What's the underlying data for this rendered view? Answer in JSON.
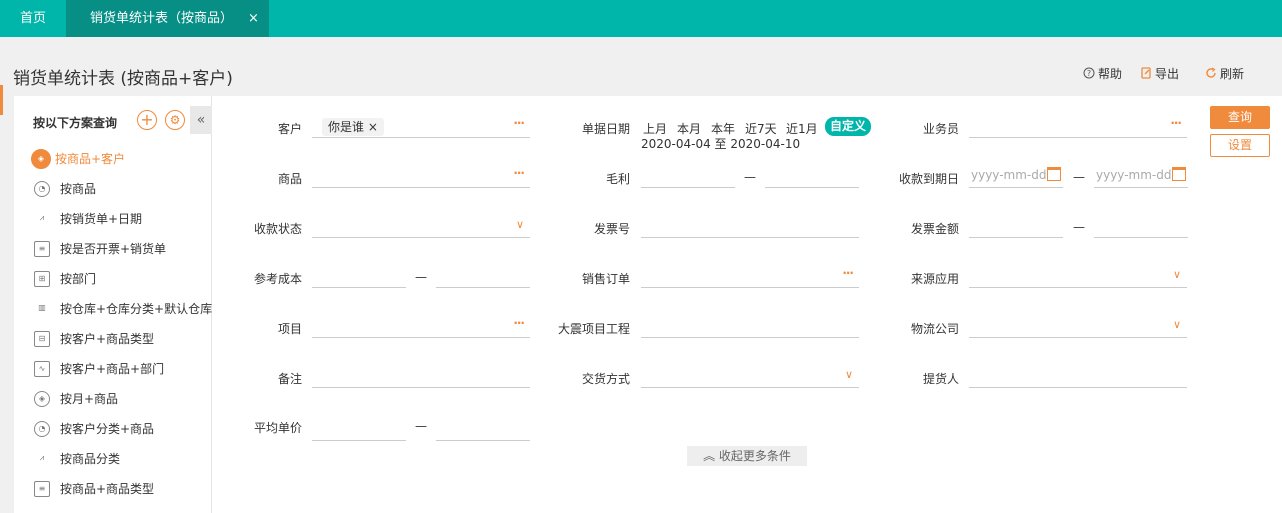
{
  "tabs": {
    "home": "首页",
    "active": "销货单统计表（按商品）",
    "close": "×"
  },
  "page": {
    "title": "销货单统计表 (按商品+客户)",
    "help": "帮助",
    "export": "导出",
    "refresh": "刷新"
  },
  "sidebar": {
    "heading": "按以下方案查询",
    "add": "+",
    "settings": "⚙",
    "collapse": "«",
    "items": [
      {
        "label": "按商品+客户",
        "icon": "box-icon"
      },
      {
        "label": "按商品",
        "icon": "pie-icon"
      },
      {
        "label": "按销货单+日期",
        "icon": "chart-icon"
      },
      {
        "label": "按是否开票+销货单",
        "icon": "card-icon"
      },
      {
        "label": "按部门",
        "icon": "dept-icon"
      },
      {
        "label": "按仓库+仓库分类+默认仓库",
        "icon": "bar-icon"
      },
      {
        "label": "按客户+商品类型",
        "icon": "layout-icon"
      },
      {
        "label": "按客户+商品+部门",
        "icon": "trend-icon"
      },
      {
        "label": "按月+商品",
        "icon": "box-icon"
      },
      {
        "label": "按客户分类+商品",
        "icon": "pie-icon"
      },
      {
        "label": "按商品分类",
        "icon": "chart-icon"
      },
      {
        "label": "按商品+商品类型",
        "icon": "card-icon"
      }
    ]
  },
  "form": {
    "customer": {
      "label": "客户",
      "tag": "你是谁 ×"
    },
    "doc_date": {
      "label": "单据日期",
      "options": [
        "上月",
        "本月",
        "本年",
        "近7天",
        "近1月"
      ],
      "custom": "自定义",
      "range": "2020-04-04 至 2020-04-10"
    },
    "salesman": {
      "label": "业务员"
    },
    "product": {
      "label": "商品"
    },
    "gross_profit": {
      "label": "毛利"
    },
    "due_date": {
      "label": "收款到期日",
      "placeholder": "yyyy-mm-dd"
    },
    "payment_status": {
      "label": "收款状态"
    },
    "invoice_no": {
      "label": "发票号"
    },
    "invoice_amount": {
      "label": "发票金额"
    },
    "ref_cost": {
      "label": "参考成本"
    },
    "sales_order": {
      "label": "销售订单"
    },
    "source_app": {
      "label": "来源应用"
    },
    "project": {
      "label": "项目"
    },
    "big_project": {
      "label": "大震项目工程"
    },
    "logistics": {
      "label": "物流公司"
    },
    "remark": {
      "label": "备注"
    },
    "delivery": {
      "label": "交货方式"
    },
    "picker": {
      "label": "提货人"
    },
    "avg_price": {
      "label": "平均单价"
    },
    "dash": "—",
    "dots": "···",
    "chevron": "∨"
  },
  "buttons": {
    "query": "查询",
    "settings": "设置",
    "more": "收起更多条件",
    "more_icon": "︽"
  }
}
